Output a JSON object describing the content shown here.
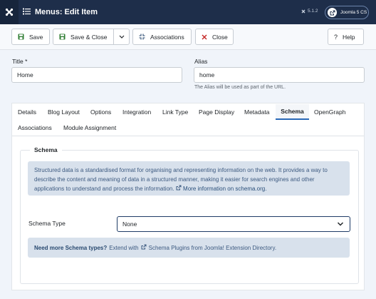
{
  "header": {
    "title": "Menus: Edit Item",
    "version": "5.1.2",
    "site_button": "Joomla 5 CS"
  },
  "toolbar": {
    "save": "Save",
    "save_close": "Save & Close",
    "associations": "Associations",
    "close": "Close",
    "help": "Help"
  },
  "form": {
    "title_label": "Title *",
    "title_value": "Home",
    "alias_label": "Alias",
    "alias_value": "home",
    "alias_hint": "The Alias will be used as part of the URL."
  },
  "tabs": [
    "Details",
    "Blog Layout",
    "Options",
    "Integration",
    "Link Type",
    "Page Display",
    "Metadata",
    "Schema",
    "OpenGraph",
    "Associations",
    "Module Assignment"
  ],
  "active_tab": "Schema",
  "schema": {
    "legend": "Schema",
    "info_text": "Structured data is a standardised format for organising and representing information on the web. It provides a way to describe the content and meaning of data in a structured manner, making it easier for search engines and other applications to understand and process the information.",
    "info_link": "More information on schema.org.",
    "type_label": "Schema Type",
    "type_value": "None",
    "more_bold": "Need more Schema types?",
    "more_text": "Extend with",
    "more_link": "Schema Plugins from Joomla! Extension Directory."
  },
  "colors": {
    "header_bg": "#1e2e4a",
    "info_bg": "#d8e1ec",
    "active_tab_border": "#2a69b8",
    "close_icon": "#c52827",
    "save_icon": "#2f7d32"
  }
}
